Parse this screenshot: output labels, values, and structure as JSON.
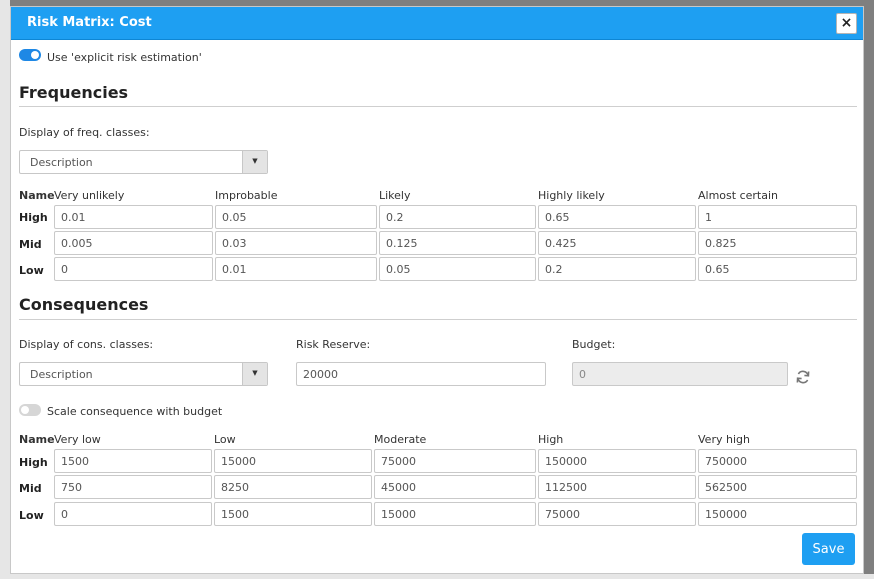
{
  "dialog": {
    "title": "Risk Matrix: Cost",
    "close_label": "×"
  },
  "explicit_toggle": {
    "label": "Use 'explicit risk estimation'",
    "checked": true
  },
  "frequencies": {
    "title": "Frequencies",
    "display_label": "Display of freq. classes:",
    "display_value": "Description",
    "name_header": "Name",
    "columns": [
      "Very unlikely",
      "Improbable",
      "Likely",
      "Highly likely",
      "Almost certain"
    ],
    "rows": [
      {
        "label": "High",
        "values": [
          "0.01",
          "0.05",
          "0.2",
          "0.65",
          "1"
        ]
      },
      {
        "label": "Mid",
        "values": [
          "0.005",
          "0.03",
          "0.125",
          "0.425",
          "0.825"
        ]
      },
      {
        "label": "Low",
        "values": [
          "0",
          "0.01",
          "0.05",
          "0.2",
          "0.65"
        ]
      }
    ]
  },
  "consequences": {
    "title": "Consequences",
    "display_label": "Display of cons. classes:",
    "display_value": "Description",
    "risk_reserve_label": "Risk Reserve:",
    "risk_reserve_value": "20000",
    "budget_label": "Budget:",
    "budget_value": "0",
    "scale_toggle": {
      "label": "Scale consequence with budget",
      "checked": false
    },
    "name_header": "Name",
    "columns": [
      "Very low",
      "Low",
      "Moderate",
      "High",
      "Very high"
    ],
    "rows": [
      {
        "label": "High",
        "values": [
          "1500",
          "15000",
          "75000",
          "150000",
          "750000"
        ]
      },
      {
        "label": "Mid",
        "values": [
          "750",
          "8250",
          "45000",
          "112500",
          "562500"
        ]
      },
      {
        "label": "Low",
        "values": [
          "0",
          "1500",
          "15000",
          "75000",
          "150000"
        ]
      }
    ]
  },
  "save_label": "Save",
  "icons": {
    "close": "close-icon",
    "dropdown": "chevron-down-icon",
    "refresh": "refresh-icon"
  },
  "colors": {
    "accent": "#1e9ff2",
    "toggle_on": "#1e88e5",
    "toggle_off": "#d6d6d6"
  }
}
